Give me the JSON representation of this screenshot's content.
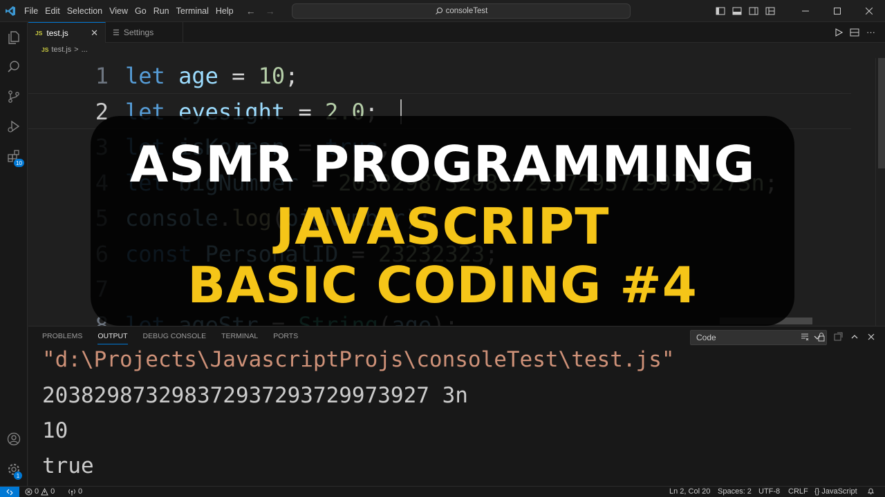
{
  "menu": [
    "File",
    "Edit",
    "Selection",
    "View",
    "Go",
    "Run",
    "Terminal",
    "Help"
  ],
  "search": {
    "text": "consoleTest"
  },
  "tabs": [
    {
      "label": "test.js",
      "icon": "JS"
    },
    {
      "label": "Settings"
    }
  ],
  "breadcrumb": {
    "file": "test.js",
    "sep": ">",
    "more": "..."
  },
  "activity_badges": {
    "extensions": "10",
    "accounts": "1"
  },
  "editor": {
    "lines": [
      {
        "n": "1",
        "tokens": [
          [
            "kw",
            "let "
          ],
          [
            "var",
            "age"
          ],
          [
            "punct",
            " = "
          ],
          [
            "num",
            "10"
          ],
          [
            "punct",
            ";"
          ]
        ]
      },
      {
        "n": "2",
        "tokens": [
          [
            "kw",
            "let "
          ],
          [
            "var",
            "eyesight"
          ],
          [
            "punct",
            " = "
          ],
          [
            "num",
            "2.0"
          ],
          [
            "punct",
            ";"
          ]
        ]
      },
      {
        "n": "3",
        "tokens": [
          [
            "kw",
            "let "
          ],
          [
            "var",
            "isKorean"
          ],
          [
            "punct",
            " = "
          ],
          [
            "kw",
            "true"
          ],
          [
            "punct",
            ";"
          ]
        ]
      },
      {
        "n": "4",
        "tokens": [
          [
            "kw",
            "let "
          ],
          [
            "var",
            "bigNumber"
          ],
          [
            "punct",
            " = "
          ],
          [
            "num",
            "203829873298372937293729973927"
          ],
          [
            "num",
            "3n"
          ],
          [
            "punct",
            ";"
          ]
        ]
      },
      {
        "n": "5",
        "tokens": [
          [
            "var",
            "console"
          ],
          [
            "punct",
            "."
          ],
          [
            "fn",
            "log"
          ],
          [
            "punct",
            "("
          ],
          [
            "var",
            "bigNumber"
          ],
          [
            "punct",
            ");"
          ]
        ]
      },
      {
        "n": "6",
        "tokens": [
          [
            "kw",
            "const "
          ],
          [
            "var",
            "PersonalID"
          ],
          [
            "punct",
            " = "
          ],
          [
            "num",
            "23232323"
          ],
          [
            "punct",
            ";"
          ]
        ]
      },
      {
        "n": "7",
        "tokens": []
      },
      {
        "n": "8",
        "tokens": [
          [
            "kw",
            "let "
          ],
          [
            "var",
            "ageStr"
          ],
          [
            "punct",
            " = "
          ],
          [
            "cls",
            "String"
          ],
          [
            "punct",
            "("
          ],
          [
            "var",
            "age"
          ],
          [
            "punct",
            ");"
          ]
        ]
      }
    ]
  },
  "overlay": {
    "title": "ASMR PROGRAMMING",
    "subtitle1": "JAVASCRIPT",
    "subtitle2": "BASIC CODING #4"
  },
  "panel": {
    "tabs": [
      "PROBLEMS",
      "OUTPUT",
      "DEBUG CONSOLE",
      "TERMINAL",
      "PORTS"
    ],
    "active_tab": "OUTPUT",
    "select_value": "Code",
    "output": [
      "\"d:\\Projects\\JavascriptProjs\\consoleTest\\test.js\"",
      "203829873298372937293729973927 3n",
      "10",
      "true"
    ]
  },
  "status": {
    "errors": "0",
    "warnings": "0",
    "ports": "0",
    "position": "Ln 2, Col 20",
    "spaces": "Spaces: 2",
    "encoding": "UTF-8",
    "eol": "CRLF",
    "language": "JavaScript"
  },
  "colors": {
    "accent": "#0078d4",
    "overlay_yellow": "#f5c518"
  }
}
